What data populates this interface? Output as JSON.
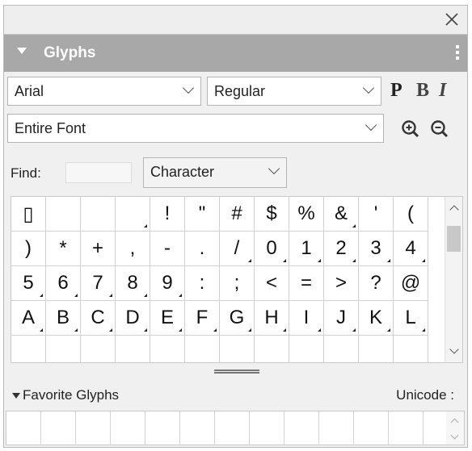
{
  "panel": {
    "title": "Glyphs",
    "icons": {
      "close": "close-icon",
      "collapse": "triangle-down-icon",
      "menu": "vertical-dots-icon"
    }
  },
  "font": {
    "family": "Arial",
    "style": "Regular",
    "style_buttons": [
      "P",
      "B",
      "I"
    ]
  },
  "subset": {
    "selected": "Entire Font",
    "zoom_icons": [
      "zoom-in-icon",
      "zoom-out-icon"
    ]
  },
  "find": {
    "label": "Find:",
    "value": "",
    "mode": "Character"
  },
  "glyphs": [
    {
      "ch": "▯",
      "mark": false
    },
    {
      "ch": "",
      "mark": false
    },
    {
      "ch": "",
      "mark": false
    },
    {
      "ch": "",
      "mark": true
    },
    {
      "ch": "!",
      "mark": false
    },
    {
      "ch": "\"",
      "mark": false
    },
    {
      "ch": "#",
      "mark": false
    },
    {
      "ch": "$",
      "mark": false
    },
    {
      "ch": "%",
      "mark": false
    },
    {
      "ch": "&",
      "mark": true
    },
    {
      "ch": "'",
      "mark": false
    },
    {
      "ch": "(",
      "mark": false
    },
    {
      "ch": ")",
      "mark": false
    },
    {
      "ch": "*",
      "mark": false
    },
    {
      "ch": "+",
      "mark": false
    },
    {
      "ch": ",",
      "mark": false
    },
    {
      "ch": "-",
      "mark": false
    },
    {
      "ch": ".",
      "mark": false
    },
    {
      "ch": "/",
      "mark": true
    },
    {
      "ch": "0",
      "mark": true
    },
    {
      "ch": "1",
      "mark": true
    },
    {
      "ch": "2",
      "mark": true
    },
    {
      "ch": "3",
      "mark": true
    },
    {
      "ch": "4",
      "mark": true
    },
    {
      "ch": "5",
      "mark": true
    },
    {
      "ch": "6",
      "mark": true
    },
    {
      "ch": "7",
      "mark": true
    },
    {
      "ch": "8",
      "mark": true
    },
    {
      "ch": "9",
      "mark": true
    },
    {
      "ch": ":",
      "mark": false
    },
    {
      "ch": ";",
      "mark": false
    },
    {
      "ch": "<",
      "mark": false
    },
    {
      "ch": "=",
      "mark": false
    },
    {
      "ch": ">",
      "mark": false
    },
    {
      "ch": "?",
      "mark": false
    },
    {
      "ch": "@",
      "mark": false
    },
    {
      "ch": "A",
      "mark": true
    },
    {
      "ch": "B",
      "mark": true
    },
    {
      "ch": "C",
      "mark": true
    },
    {
      "ch": "D",
      "mark": true
    },
    {
      "ch": "E",
      "mark": true
    },
    {
      "ch": "F",
      "mark": true
    },
    {
      "ch": "G",
      "mark": true
    },
    {
      "ch": "H",
      "mark": true
    },
    {
      "ch": "I",
      "mark": true
    },
    {
      "ch": "J",
      "mark": true
    },
    {
      "ch": "K",
      "mark": true
    },
    {
      "ch": "L",
      "mark": true
    },
    {
      "ch": "",
      "mark": false
    },
    {
      "ch": "",
      "mark": false
    },
    {
      "ch": "",
      "mark": false
    },
    {
      "ch": "",
      "mark": false
    },
    {
      "ch": "",
      "mark": false
    },
    {
      "ch": "",
      "mark": false
    },
    {
      "ch": "",
      "mark": false
    },
    {
      "ch": "",
      "mark": false
    },
    {
      "ch": "",
      "mark": false
    },
    {
      "ch": "",
      "mark": false
    },
    {
      "ch": "",
      "mark": false
    },
    {
      "ch": "",
      "mark": false
    }
  ],
  "favorites": {
    "label": "Favorite Glyphs",
    "unicode_label": "Unicode :",
    "slots": 13
  },
  "colors": {
    "title_bar": "#a8a8a8",
    "panel_bg": "#f0f0f0"
  }
}
